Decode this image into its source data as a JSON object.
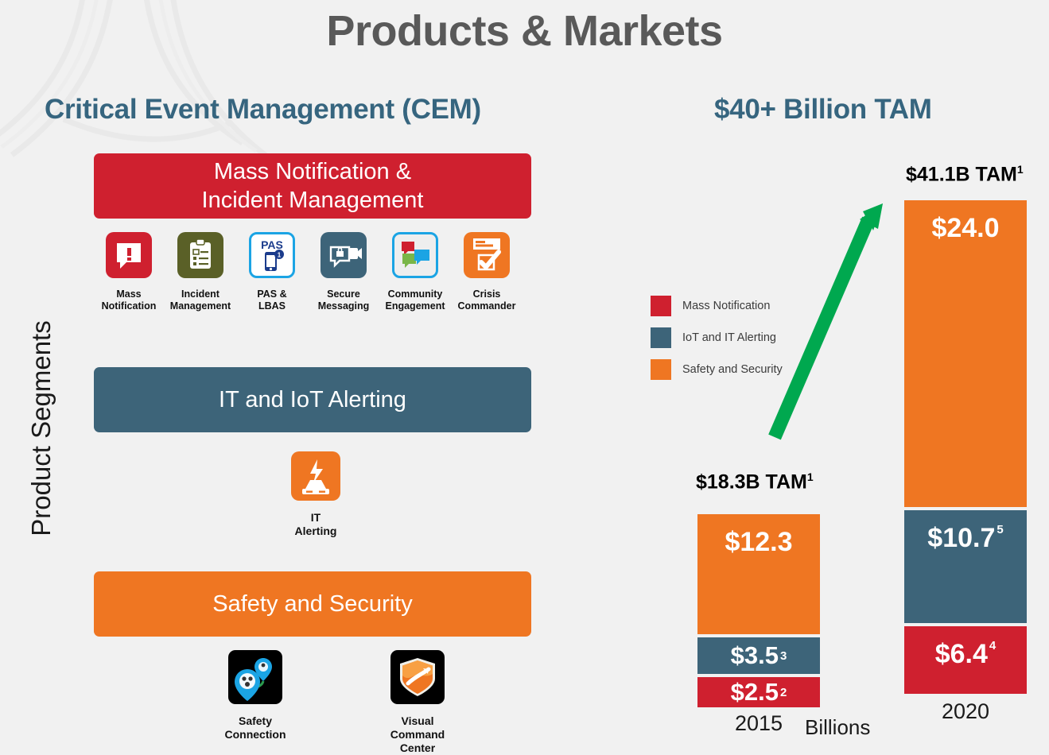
{
  "page_title": "Products & Markets",
  "left_panel": {
    "heading": "Critical Event Management (CEM)",
    "axis_label": "Product Segments",
    "segments": [
      {
        "name": "mass-notification",
        "label": "Mass Notification &\nIncident Management",
        "color": "#cf202f"
      },
      {
        "name": "it-iot-alerting",
        "label": "IT and IoT Alerting",
        "color": "#3d6479"
      },
      {
        "name": "safety-security",
        "label": "Safety and Security",
        "color": "#ef7622"
      }
    ],
    "banner_mn_line1": "Mass Notification &",
    "banner_mn_line2": "Incident Management",
    "banner_it": "IT and IoT Alerting",
    "banner_ss": "Safety and Security",
    "products_row1": [
      {
        "icon": "alert-speech-bubble-icon",
        "label": "Mass\nNotification",
        "line1": "Mass",
        "line2": "Notification",
        "color": "#cf202f"
      },
      {
        "icon": "clipboard-checklist-icon",
        "label": "Incident\nManagement",
        "line1": "Incident",
        "line2": "Management",
        "color": "#5a6027"
      },
      {
        "icon": "pas-phone-icon",
        "label": "PAS & LBAS",
        "line1": "PAS & LBAS",
        "line2": "",
        "color": "#ffffff"
      },
      {
        "icon": "secure-video-message-icon",
        "label": "Secure\nMessaging",
        "line1": "Secure",
        "line2": "Messaging",
        "color": "#3d6479"
      },
      {
        "icon": "community-chat-bubbles-icon",
        "label": "Community\nEngagement",
        "line1": "Community",
        "line2": "Engagement",
        "color": "#eeeeee"
      },
      {
        "icon": "crisis-commander-checkbox-icon",
        "label": "Crisis\nCommander",
        "line1": "Crisis",
        "line2": "Commander",
        "color": "#ef7622"
      }
    ],
    "product_it": {
      "icon": "server-lightning-icon",
      "line1": "IT",
      "line2": "Alerting",
      "color": "#ef7622"
    },
    "products_row3": [
      {
        "icon": "safety-connection-map-pin-icon",
        "line1": "Safety",
        "line2": "Connection",
        "color": "#000000"
      },
      {
        "icon": "visual-command-center-shield-icon",
        "line1": "Visual",
        "line2": "Command Center",
        "color": "#000000"
      }
    ]
  },
  "right_panel": {
    "heading": "$40+ Billion TAM",
    "growth_arrow": "green-up-arrow-icon",
    "arrow_color": "#00a84f"
  },
  "chart_data": {
    "type": "bar",
    "subtype": "stacked",
    "title": "$40+ Billion TAM",
    "xlabel": "",
    "ylabel": "Billions",
    "axis_unit_label": "Billions",
    "categories": [
      "2015",
      "2020"
    ],
    "totals": [
      "$18.3B TAM",
      "$41.1B TAM"
    ],
    "total_values": [
      18.3,
      41.1
    ],
    "total_footnotes": [
      "1",
      "1"
    ],
    "ylim": [
      0,
      41.1
    ],
    "grid": false,
    "legend_position": "left-middle",
    "series": [
      {
        "name": "Mass Notification",
        "color": "#cf202f",
        "values": [
          2.5,
          6.4
        ],
        "labels": [
          "$2.5",
          "$6.4"
        ],
        "footnotes": [
          "2",
          "4"
        ]
      },
      {
        "name": "IoT and IT Alerting",
        "color": "#3d6479",
        "values": [
          3.5,
          10.7
        ],
        "labels": [
          "$3.5",
          "$10.7"
        ],
        "footnotes": [
          "3",
          "5"
        ]
      },
      {
        "name": "Safety and Security",
        "color": "#ef7622",
        "values": [
          12.3,
          24.0
        ],
        "labels": [
          "$12.3",
          "$24.0"
        ],
        "footnotes": [
          "",
          ""
        ]
      }
    ]
  }
}
